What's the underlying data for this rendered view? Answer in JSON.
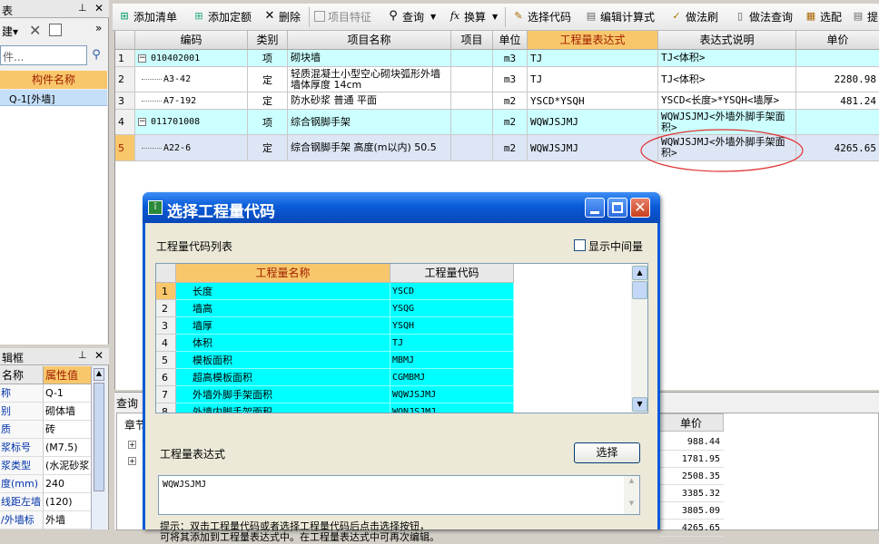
{
  "left_top": {
    "title_fragment": "表",
    "pin": "ꟸ",
    "close": "✕",
    "build_label": "建▾",
    "search_placeholder": "件...",
    "header": "构件名称",
    "item": "Q-1[外墙]"
  },
  "left_props": {
    "title_fragment": "辑框",
    "col_name": "名称",
    "col_value": "属性值",
    "rows": [
      {
        "name": "称",
        "value": "Q-1"
      },
      {
        "name": "别",
        "value": "砌体墙"
      },
      {
        "name": "质",
        "value": "砖"
      },
      {
        "name": "浆标号",
        "value": "(M7.5)"
      },
      {
        "name": "浆类型",
        "value": "(水泥砂浆"
      },
      {
        "name": "度(mm)",
        "value": "240"
      },
      {
        "name": "线距左墙",
        "value": "(120)"
      },
      {
        "name": "/外墙标",
        "value": "外墙"
      }
    ]
  },
  "toolbar": {
    "add_list": "添加清单",
    "add_quota": "添加定额",
    "delete": "删除",
    "item_feature": "项目特征",
    "query": "查询",
    "convert": "换算",
    "select_code": "选择代码",
    "edit_formula": "编辑计算式",
    "method_brush": "做法刷",
    "method_query": "做法查询",
    "select_config": "选配",
    "extract": "提"
  },
  "grid": {
    "headers": [
      "编码",
      "类别",
      "项目名称",
      "项目",
      "单位",
      "工程量表达式",
      "表达式说明",
      "单价"
    ],
    "rows": [
      {
        "num": "1",
        "code": "010402001",
        "type": "项",
        "name": "砌块墙",
        "unit": "m3",
        "expr": "TJ",
        "desc": "TJ<体积>",
        "price": "",
        "tree": "minus"
      },
      {
        "num": "2",
        "code": "A3-42",
        "type": "定",
        "name": "轻质混凝土小型空心砌块弧形外墙 墙体厚度 14cm",
        "unit": "m3",
        "expr": "TJ",
        "desc": "TJ<体积>",
        "price": "2280.98",
        "tree": "child"
      },
      {
        "num": "3",
        "code": "A7-192",
        "type": "定",
        "name": "防水砂浆 普通 平面",
        "unit": "m2",
        "expr": "YSCD*YSQH",
        "desc": "YSCD<长度>*YSQH<墙厚>",
        "price": "481.24",
        "tree": "child"
      },
      {
        "num": "4",
        "code": "011701008",
        "type": "项",
        "name": "综合钢脚手架",
        "unit": "m2",
        "expr": "WQWJSJMJ",
        "desc": "WQWJSJMJ<外墙外脚手架面积>",
        "price": "",
        "tree": "minus"
      },
      {
        "num": "5",
        "code": "A22-6",
        "type": "定",
        "name": "综合钢脚手架 高度(m以内) 50.5",
        "unit": "m2",
        "expr": "WQWJSJMJ",
        "desc": "WQWJSJMJ<外墙外脚手架面积>",
        "price": "4265.65",
        "tree": "child"
      }
    ]
  },
  "bottom_panel": {
    "tab": "查询",
    "chapter": "章节",
    "col_price": "单价",
    "prices": [
      "988.44",
      "1781.95",
      "2508.35",
      "3385.32",
      "3805.09",
      "4265.65"
    ]
  },
  "dialog": {
    "title": "选择工程量代码",
    "list_label": "工程量代码列表",
    "show_intermediate": "显示中间量",
    "col_name": "工程量名称",
    "col_code": "工程量代码",
    "items": [
      {
        "num": "1",
        "name": "长度",
        "code": "YSCD"
      },
      {
        "num": "2",
        "name": "墙高",
        "code": "YSQG"
      },
      {
        "num": "3",
        "name": "墙厚",
        "code": "YSQH"
      },
      {
        "num": "4",
        "name": "体积",
        "code": "TJ"
      },
      {
        "num": "5",
        "name": "模板面积",
        "code": "MBMJ"
      },
      {
        "num": "6",
        "name": "超高模板面积",
        "code": "CGMBMJ"
      },
      {
        "num": "7",
        "name": "外墙外脚手架面积",
        "code": "WQWJSJMJ"
      },
      {
        "num": "8",
        "name": "外墙内脚手架面积",
        "code": "WQNJSJMJ"
      }
    ],
    "expr_label": "工程量表达式",
    "select_button": "选择",
    "expr_value": "WQWJSJMJ",
    "hint_line1": "提示：双击工程量代码或者选择工程量代码后点击选择按钮，",
    "hint_line2": "可将其添加到工程量表达式中。在工程量表达式中可再次编辑。"
  },
  "colors": {
    "cyan": "#00ffff",
    "orange_header": "#f9c76b",
    "dialog_title": "#0a5bd8",
    "annotation": "#e03030"
  }
}
